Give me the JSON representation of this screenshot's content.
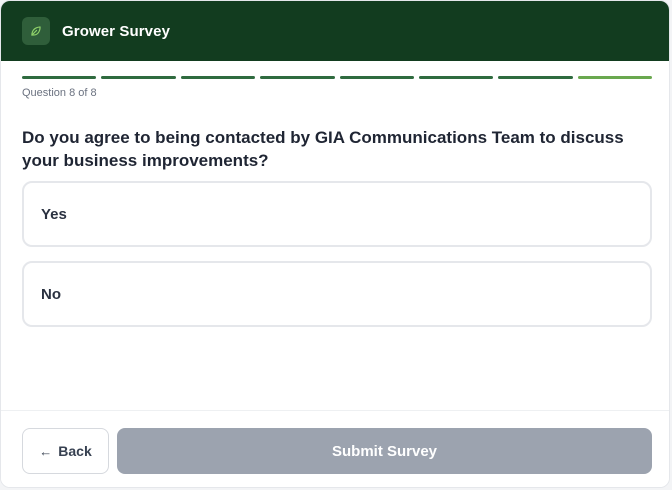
{
  "header": {
    "title": "Grower Survey",
    "logo_icon": "leaf-icon",
    "background": "#123c1f"
  },
  "progress": {
    "total_questions": 8,
    "current_question": 8,
    "counter_text": "Question 8 of 8",
    "complete_color": "#2f6b3f",
    "active_color": "#6aa84f"
  },
  "question": {
    "text": "Do you agree to being contacted by GIA Communications Team to discuss your business improvements?"
  },
  "options": [
    {
      "label": "Yes"
    },
    {
      "label": "No"
    }
  ],
  "footer": {
    "back_label": "Back",
    "back_icon": "arrow-left-icon",
    "submit_label": "Submit Survey",
    "submit_color": "#9ca3af"
  }
}
